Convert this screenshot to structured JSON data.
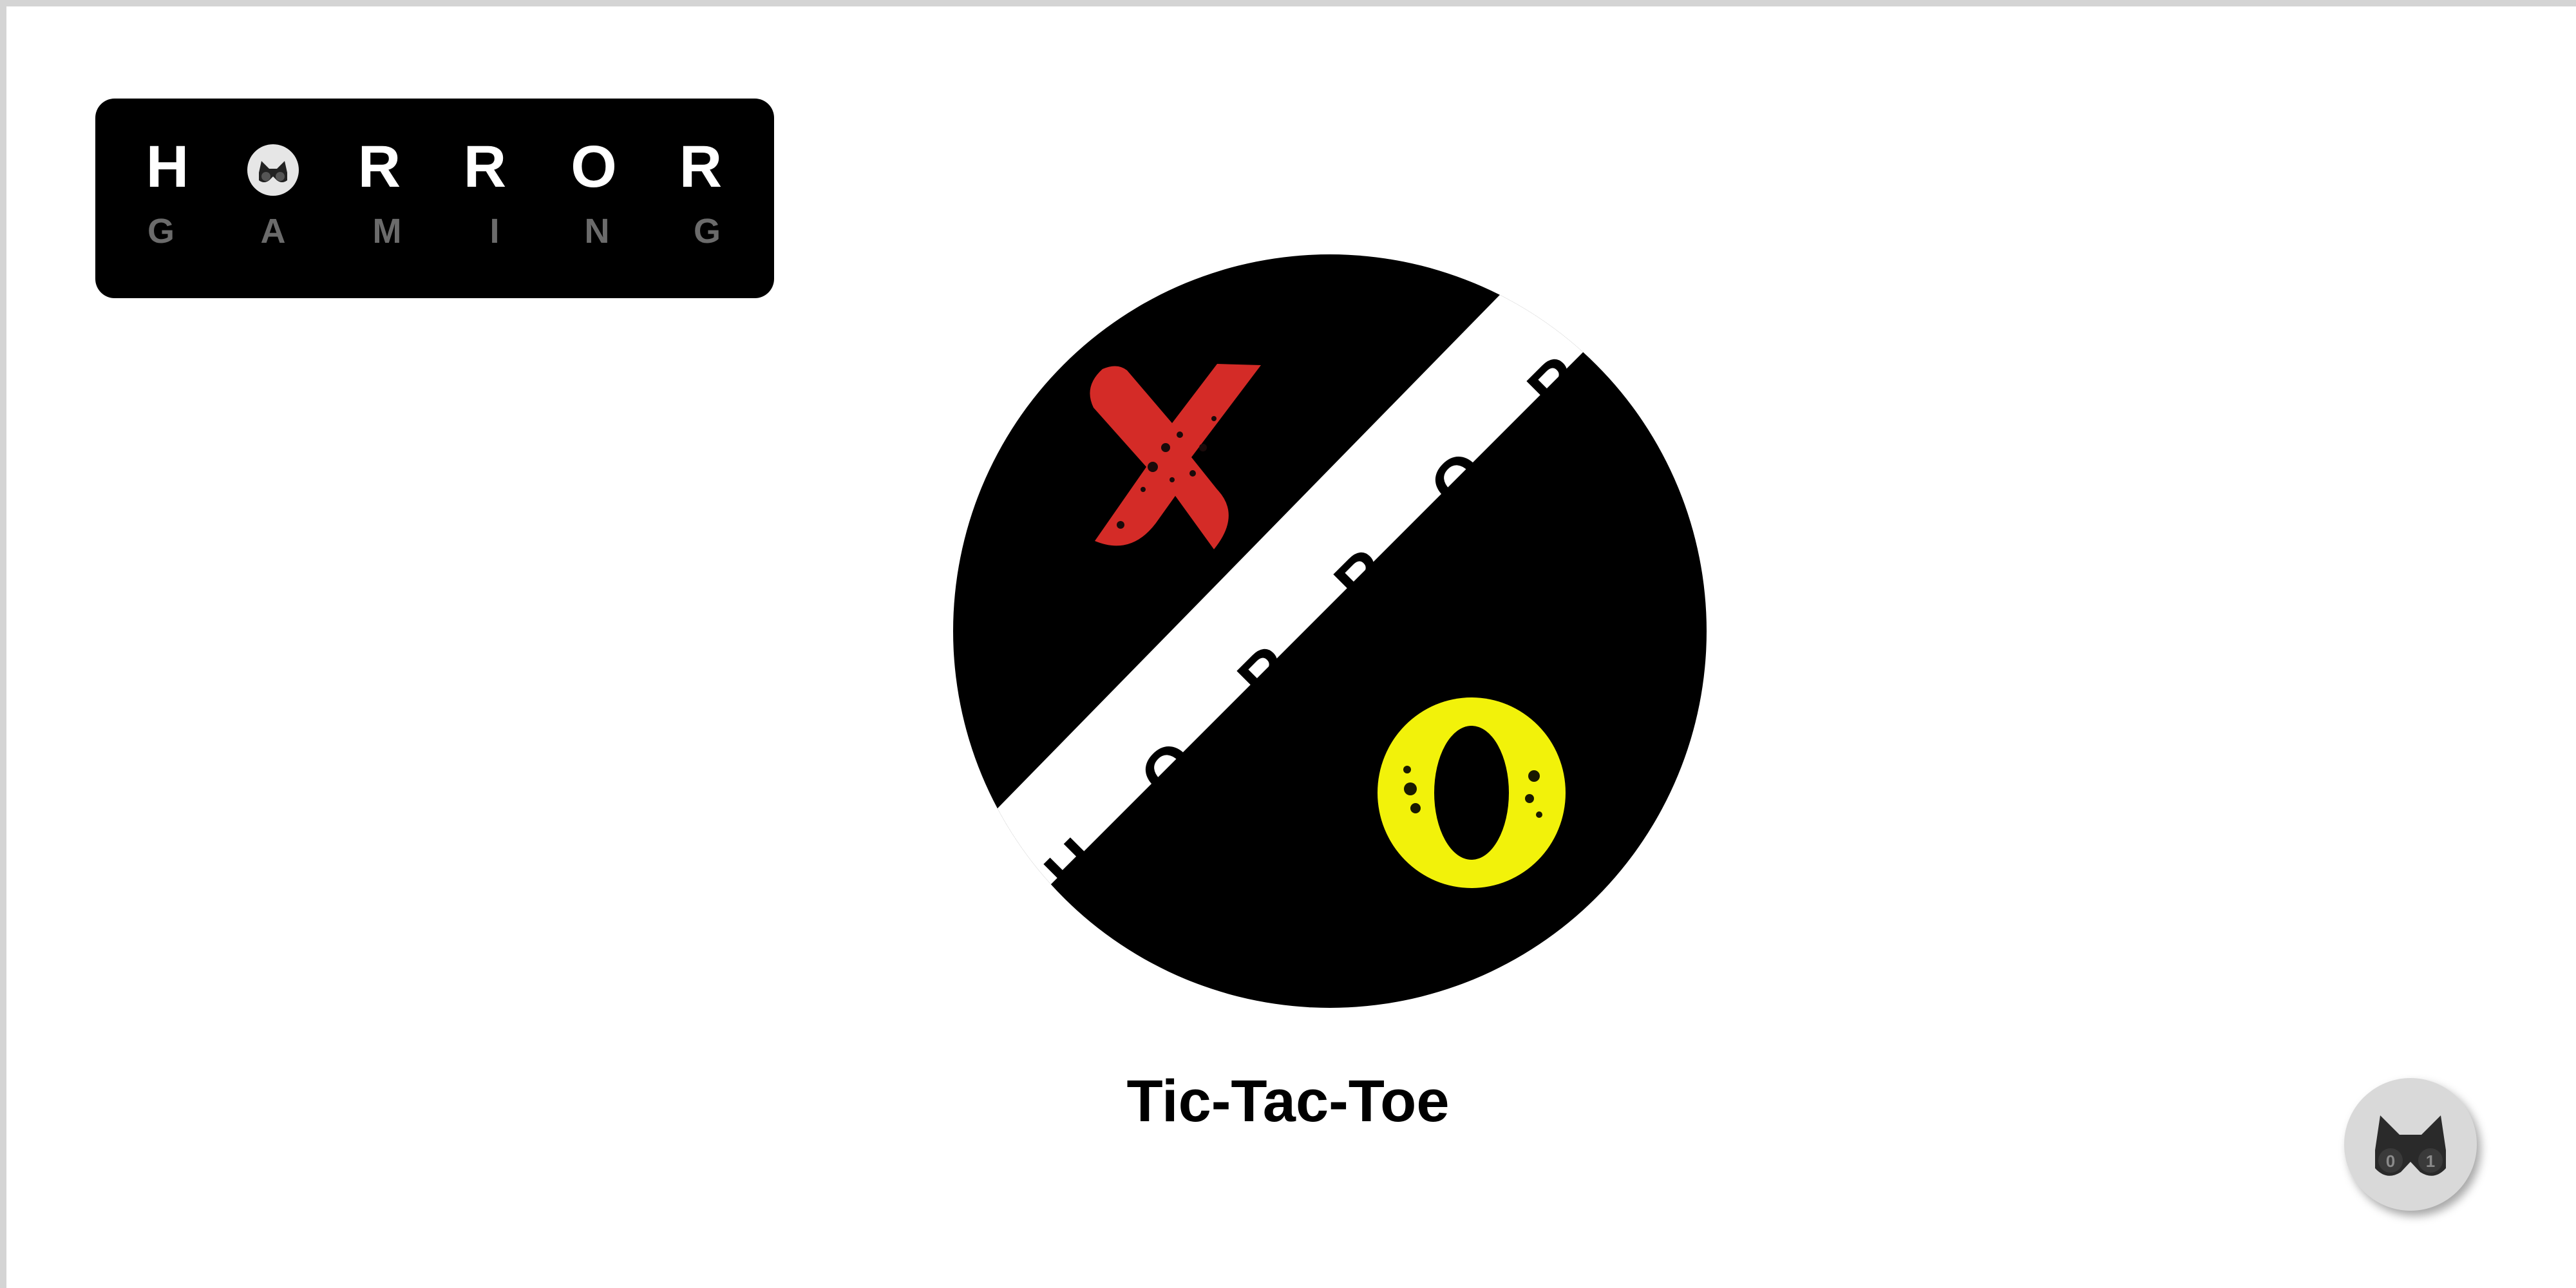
{
  "brand": {
    "top_letters": [
      "H",
      "O",
      "R",
      "R",
      "O",
      "R"
    ],
    "bottom_letters": [
      "G",
      "A",
      "M",
      "I",
      "N",
      "G"
    ]
  },
  "logo": {
    "x_mark": "X",
    "o_mark": "O",
    "band_letters": [
      "H",
      "O",
      "R",
      "R",
      "O",
      "R"
    ]
  },
  "game_title": "Tic-Tac-Toe",
  "float_button": {
    "left_eye": "0",
    "right_eye": "1"
  },
  "colors": {
    "x_red": "#d42b27",
    "o_yellow": "#f2f20a",
    "disc": "#000000",
    "brand_bg": "#000000",
    "brand_sub": "#6b6b6b"
  }
}
